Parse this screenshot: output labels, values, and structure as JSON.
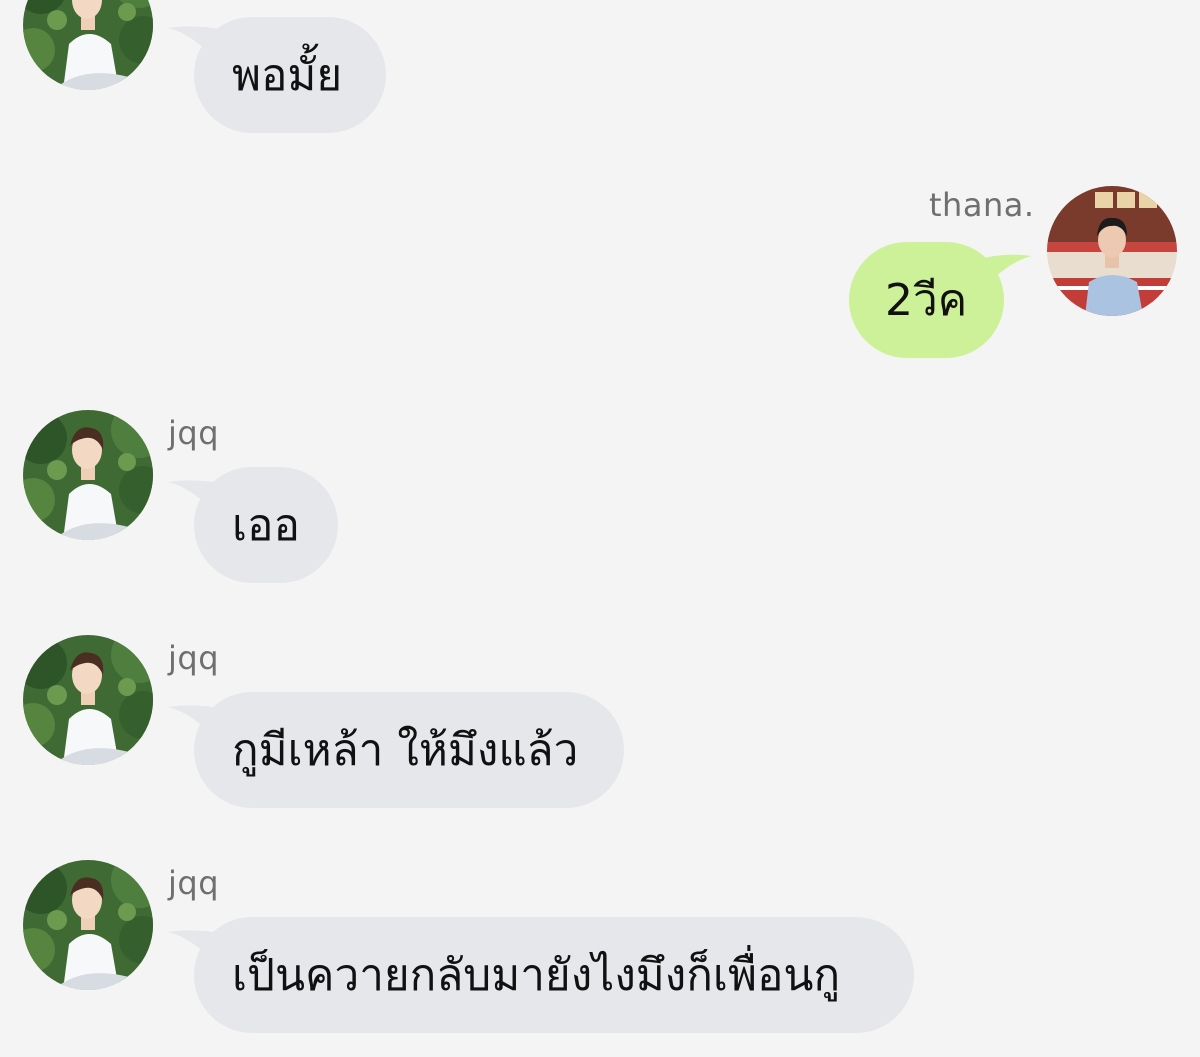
{
  "messages": [
    {
      "sender": "",
      "avatar": "friend-avatar",
      "text": "พอมั้ย"
    },
    {
      "sender": "thana.",
      "avatar": "self-avatar",
      "text": "2วีค"
    },
    {
      "sender": "jqq",
      "avatar": "friend-avatar",
      "text": "เออ"
    },
    {
      "sender": "jqq",
      "avatar": "friend-avatar",
      "text": "กูมีเหล้า ให้มึงแล้ว"
    },
    {
      "sender": "jqq",
      "avatar": "friend-avatar",
      "text": "เป็นควายกลับมายังไงมึงก็เพื่อนกู"
    }
  ],
  "colors": {
    "background": "#f4f4f4",
    "incoming_bubble": "#e5e7ea",
    "outgoing_bubble": "#cdf198",
    "sender_name": "#6f6f6f"
  }
}
